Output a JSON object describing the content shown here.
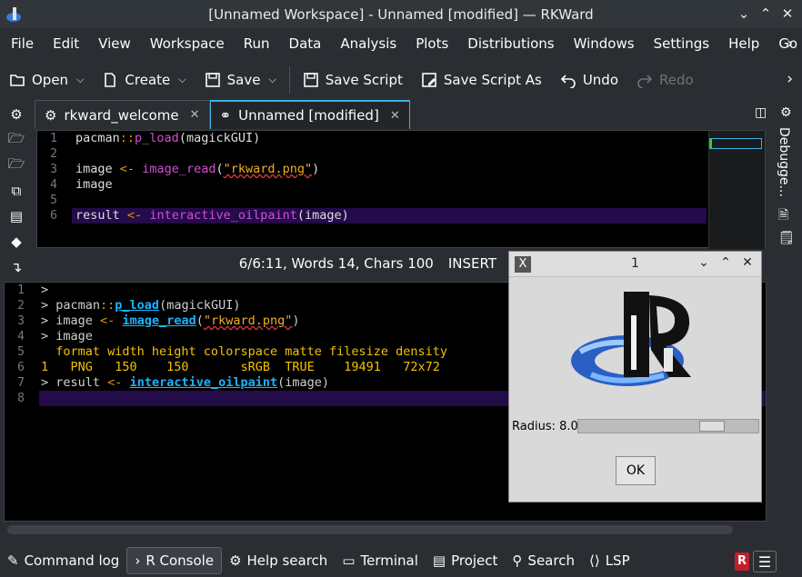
{
  "window": {
    "title": "[Unnamed Workspace] - Unnamed [modified] — RKWard"
  },
  "menubar": {
    "items": [
      "File",
      "Edit",
      "View",
      "Workspace",
      "Run",
      "Data",
      "Analysis",
      "Plots",
      "Distributions",
      "Windows",
      "Settings",
      "Help",
      "Go"
    ]
  },
  "toolbar": {
    "open": "Open",
    "create": "Create",
    "save": "Save",
    "save_script": "Save Script",
    "save_script_as": "Save Script As",
    "undo": "Undo",
    "redo": "Redo"
  },
  "tabs": [
    {
      "label": "rkward_welcome"
    },
    {
      "label": "Unnamed [modified]"
    }
  ],
  "right_panel": {
    "debugger_label": "Debugge..."
  },
  "editor": {
    "line_numbers": [
      "1",
      "2",
      "3",
      "4",
      "5",
      "6"
    ],
    "lines": {
      "l1_a": "pacman",
      "l1_op": "::",
      "l1_fn": "p_load",
      "l1_b": "(magickGUI)",
      "l3_a": "image ",
      "l3_op": "<-",
      "l3_fn": "image_read",
      "l3_p1": "(",
      "l3_str": "\"rkward.png\"",
      "l3_p2": ")",
      "l4": "image",
      "l6_a": "result ",
      "l6_op": "<-",
      "l6_fn": "interactive_oilpaint",
      "l6_b": "(image)"
    }
  },
  "statusline": {
    "position": "6/6:11, Words 14, Chars 100",
    "mode": "INSERT"
  },
  "console": {
    "line_numbers": [
      "1",
      "2",
      "3",
      "4",
      "5",
      "6",
      "7",
      "8"
    ],
    "lines": {
      "c1": ">",
      "c2_a": "> pacman",
      "c2_op": "::",
      "c2_fn": "p_load",
      "c2_b": "(magickGUI)",
      "c3_a": "> image ",
      "c3_op": "<-",
      "c3_fn": "image_read",
      "c3_p1": "(",
      "c3_str": "\"rkward.png\"",
      "c3_p2": ")",
      "c4": "> image",
      "c5": "  format width height colorspace matte filesize density",
      "c6": "1   PNG   150    150       sRGB  TRUE    19491   72x72",
      "c7_a": "> result ",
      "c7_op": "<-",
      "c7_fn": "interactive_oilpaint",
      "c7_b": "(image)"
    }
  },
  "bottombar": {
    "items": [
      "Command log",
      "R Console",
      "Help search",
      "Terminal",
      "Project",
      "Search",
      "LSP"
    ],
    "r_badge": "R"
  },
  "dialog": {
    "title": "1",
    "radius_label": "Radius: 8.0",
    "radius_fraction": 0.78,
    "ok": "OK"
  },
  "colors": {
    "accent": "#3daee9",
    "operator": "#e89200",
    "function": "#d14fd4",
    "console_function": "#19b4ff",
    "string": "#f2ad23",
    "output": "#f2c200",
    "current_line": "#240b4a"
  }
}
